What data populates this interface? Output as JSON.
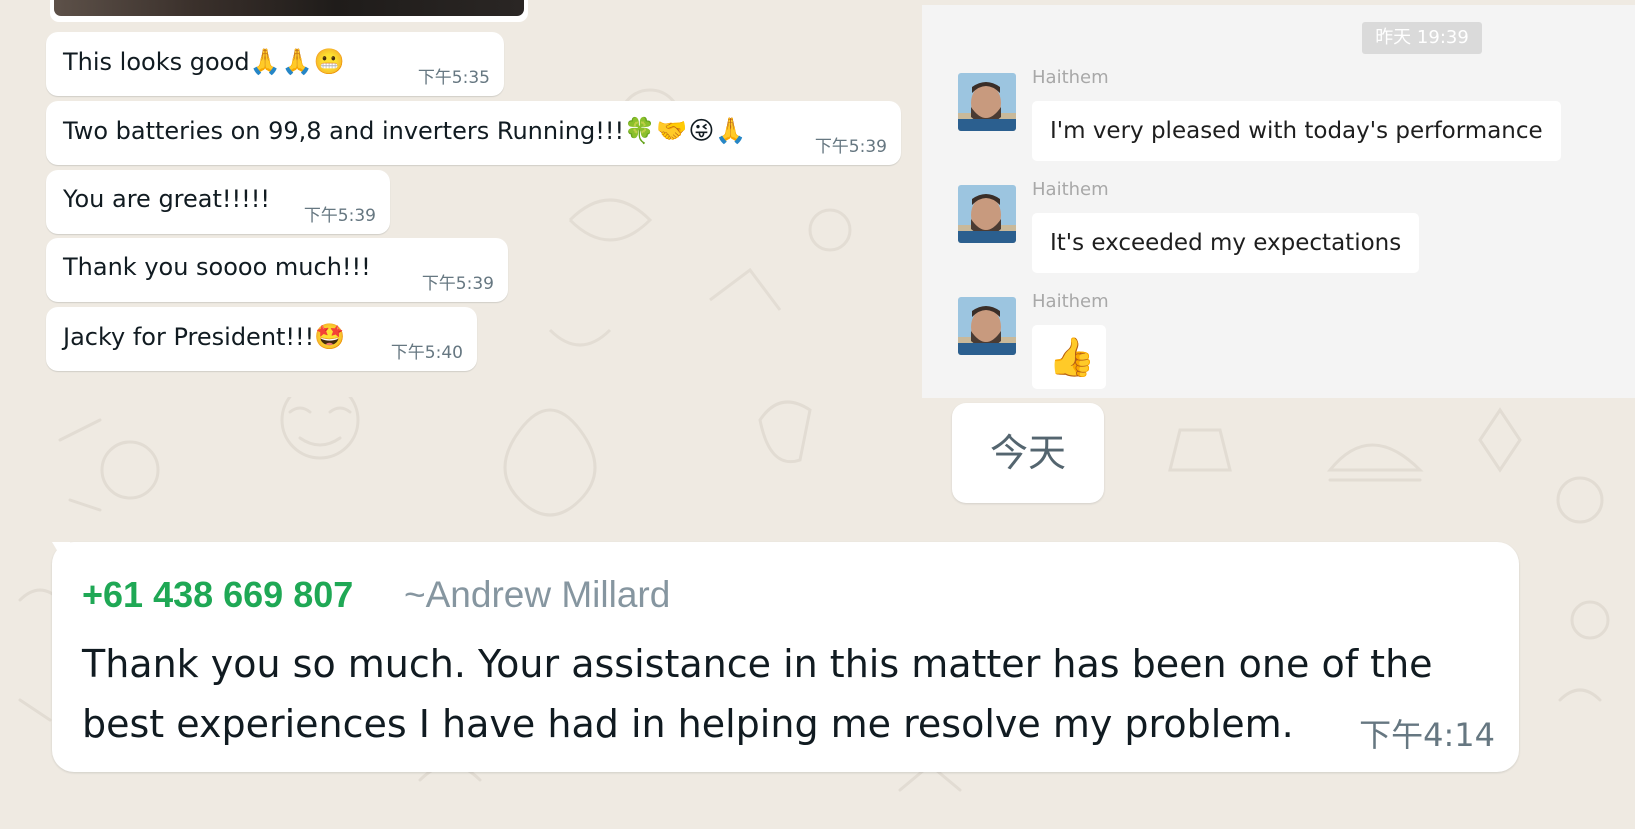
{
  "left_panel": {
    "messages": [
      {
        "text": "This looks good",
        "emoji": "🙏🙏😬",
        "time": "下午5:35"
      },
      {
        "text": "Two batteries on 99,8 and inverters Running!!!",
        "emoji": "🍀🤝😜🙏",
        "time": "下午5:39"
      },
      {
        "text": "You are great!!!!!",
        "emoji": "",
        "time": "下午5:39"
      },
      {
        "text": "Thank you soooo much!!!",
        "emoji": "",
        "time": "下午5:39"
      },
      {
        "text": "Jacky for President!!!",
        "emoji": "🤩",
        "time": "下午5:40"
      }
    ]
  },
  "right_panel": {
    "date_label": "昨天 19:39",
    "messages": [
      {
        "sender": "Haithem",
        "text": "I'm very pleased with today's performance"
      },
      {
        "sender": "Haithem",
        "text": "It's exceeded my expectations"
      },
      {
        "sender": "Haithem",
        "text": "👍"
      }
    ]
  },
  "today_label": "今天",
  "big_message": {
    "phone": "+61 438 669 807",
    "alias": "~Andrew Millard",
    "text": "Thank you so much. Your assistance in this matter has been one of the best experiences I have had in helping me resolve my problem.",
    "time": "下午4:14"
  },
  "colors": {
    "wallpaper": "#efeae2",
    "bubble": "#ffffff",
    "phone_green": "#1fa855",
    "timestamp_gray": "#667781",
    "right_panel_bg": "#f4f4f4"
  }
}
